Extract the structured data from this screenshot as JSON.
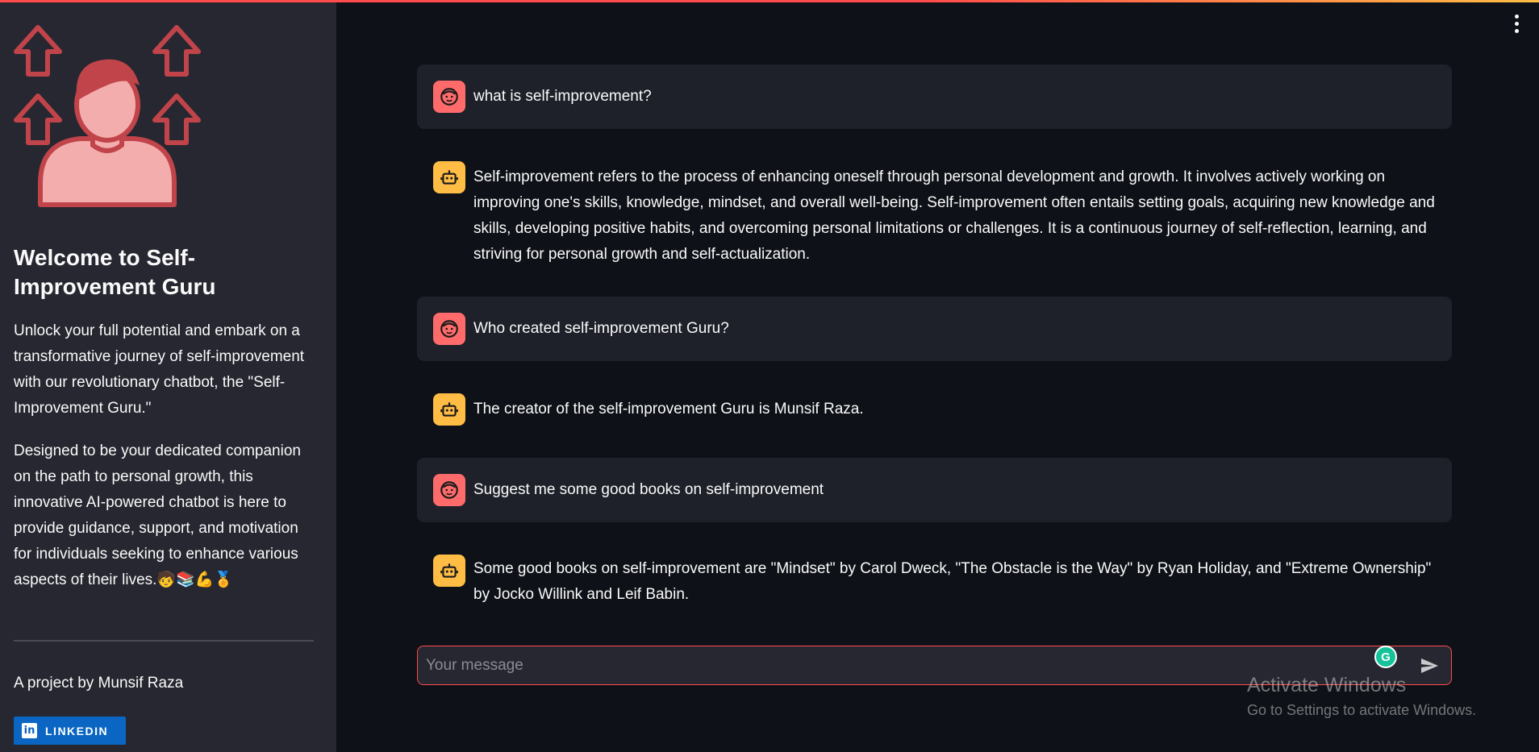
{
  "sidebar": {
    "title": "Welcome to Self-Improvement Guru",
    "intro": "Unlock your full potential and embark on a transformative journey of self-improvement with our revolutionary chatbot, the \"Self-Improvement Guru.\"",
    "description": "Designed to be your dedicated companion on the path to personal growth, this innovative AI-powered chatbot is here to provide guidance, support, and motivation for individuals seeking to enhance various aspects of their lives.🧒📚💪🏅",
    "credit": "A project by Munsif Raza",
    "linkedin_label": "LINKEDIN",
    "logo_icon": "self-improvement-person-arrows-icon"
  },
  "chat": {
    "messages": [
      {
        "role": "user",
        "text": "what is self-improvement?"
      },
      {
        "role": "assistant",
        "text": "Self-improvement refers to the process of enhancing oneself through personal development and growth. It involves actively working on improving one's skills, knowledge, mindset, and overall well-being. Self-improvement often entails setting goals, acquiring new knowledge and skills, developing positive habits, and overcoming personal limitations or challenges. It is a continuous journey of self-reflection, learning, and striving for personal growth and self-actualization."
      },
      {
        "role": "user",
        "text": "Who created self-improvement Guru?"
      },
      {
        "role": "assistant",
        "text": "The creator of the self-improvement Guru is Munsif Raza."
      },
      {
        "role": "user",
        "text": "Suggest me some good books on self-improvement"
      },
      {
        "role": "assistant",
        "text": "Some good books on self-improvement are \"Mindset\" by Carol Dweck, \"The Obstacle is the Way\" by Ryan Holiday, and \"Extreme Ownership\" by Jocko Willink and Leif Babin."
      }
    ],
    "input_placeholder": "Your message",
    "input_value": ""
  },
  "watermark": {
    "line1": "Activate Windows",
    "line2": "Go to Settings to activate Windows."
  },
  "colors": {
    "accent": "#ff4b4b",
    "user_avatar": "#ff6b6b",
    "bot_avatar": "#ffbd45",
    "sidebar_bg": "#262730",
    "main_bg": "#0e1117"
  }
}
